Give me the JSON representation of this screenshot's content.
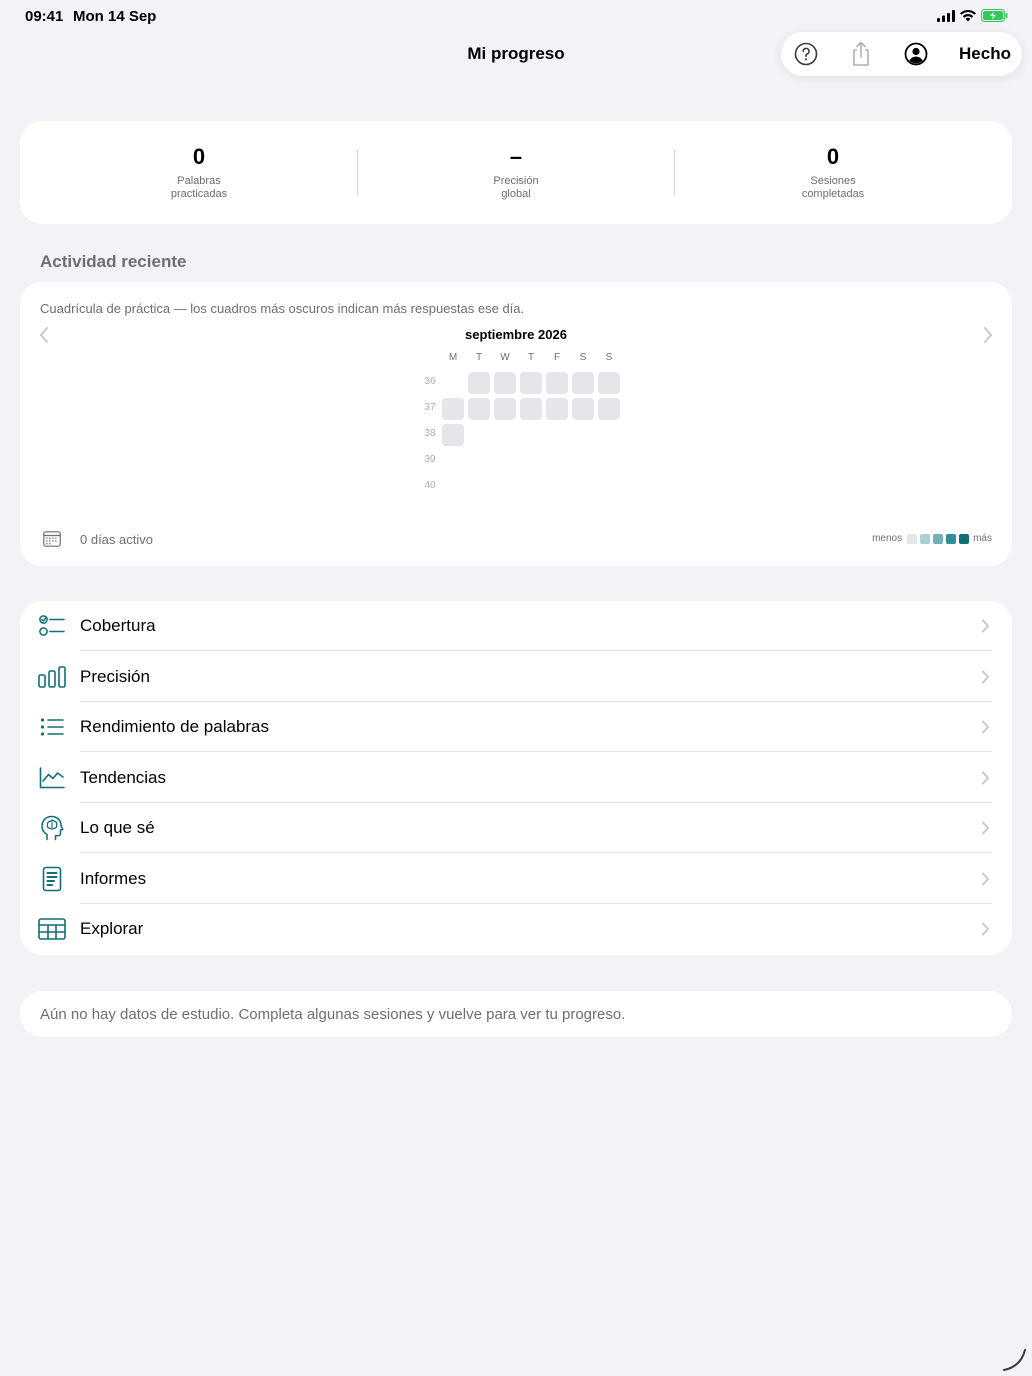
{
  "status_bar": {
    "time": "09:41",
    "date": "Mon 14 Sep"
  },
  "nav": {
    "title": "Mi progreso",
    "done_label": "Hecho",
    "icons": [
      "help-circle-icon",
      "share-icon",
      "account-icon"
    ]
  },
  "stats": [
    {
      "value": "0",
      "label": "Palabras\npracticadas"
    },
    {
      "value": "–",
      "label": "Precisión\nglobal"
    },
    {
      "value": "0",
      "label": "Sesiones\ncompletadas"
    }
  ],
  "activity": {
    "section_title": "Actividad reciente",
    "description": "Cuadrícula de práctica — los cuadros más oscuros indican más respuestas ese día.",
    "month": "septiembre 2026",
    "weekdays": [
      "M",
      "T",
      "W",
      "T",
      "F",
      "S",
      "S"
    ],
    "weeks": [
      "36",
      "37",
      "38",
      "39",
      "40"
    ],
    "active_days": "0 días activo",
    "legend_less": "menos",
    "legend_more": "más",
    "legend_colors": [
      "#e5e5ea",
      "#a9d1d4",
      "#6db3b8",
      "#2e8f96",
      "#0f6f76"
    ]
  },
  "menu": [
    {
      "label": "Cobertura",
      "icon": "checklist-icon"
    },
    {
      "label": "Precisión",
      "icon": "bar-chart-icon"
    },
    {
      "label": "Rendimiento de palabras",
      "icon": "list-bullet-icon"
    },
    {
      "label": "Tendencias",
      "icon": "line-chart-icon"
    },
    {
      "label": "Lo que sé",
      "icon": "brain-head-icon"
    },
    {
      "label": "Informes",
      "icon": "document-icon"
    },
    {
      "label": "Explorar",
      "icon": "table-icon"
    }
  ],
  "empty_state": "Aún no hay datos de estudio. Completa algunas sesiones y vuelve para ver tu progreso.",
  "colors": {
    "accent": "#0f6f76",
    "background": "#f2f2f7",
    "card": "#ffffff",
    "secondary_text": "#6e6e73"
  }
}
